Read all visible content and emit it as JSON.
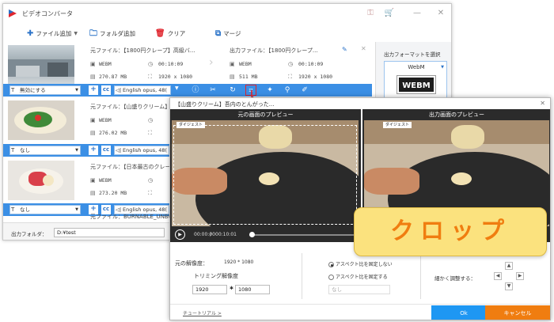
{
  "app": {
    "title": "ビデオコンバータ",
    "colors": {
      "accent": "#3b8fe5",
      "highlight": "#e0262e",
      "ok": "#1e97f3",
      "cancel": "#f07d10"
    }
  },
  "toolbar": {
    "add_file": "ファイル追加",
    "add_folder": "フォルダ追加",
    "clear": "クリア",
    "merge": "マージ"
  },
  "rows": [
    {
      "src_name": "元ファイル：【1800円クレープ】高級バ...",
      "src_format": "WEBM",
      "src_duration": "00:10:09",
      "src_size": "270.87 MB",
      "src_resolution": "1920 x 1080",
      "out_name": "出力ファイル：【1800円クレープ...",
      "out_format": "WEBM",
      "out_duration": "00:10:09",
      "out_size": "511 MB",
      "out_resolution": "1920 x 1080",
      "subtitle": "無効にする",
      "audio": "English opus, 48("
    },
    {
      "src_name": "元ファイル：【山盛りクリーム】",
      "src_format": "WEBM",
      "src_size": "276.02 MB",
      "subtitle": "なし",
      "audio": "English opus, 48("
    },
    {
      "src_name": "元ファイル：【日本最古のクレー",
      "src_format": "WEBM",
      "src_size": "273.20 MB",
      "subtitle": "なし",
      "audio": "English opus, 48("
    },
    {
      "src_name": "元ファイル：BURNABLE_UNBURNABL"
    }
  ],
  "right_panel": {
    "label": "出力フォーマットを選択",
    "format": "WebM",
    "format_logo": "WEBM"
  },
  "bottom": {
    "output_folder_label": "出力フォルダ：",
    "output_folder_value": "D:¥test"
  },
  "crop_dialog": {
    "title": "【山盛りクリーム】吾内のとんがった...",
    "original_preview_label": "元の画面のプレビュー",
    "output_preview_label": "出力画面のプレビュー",
    "stamp": "ダイジェスト",
    "time_current": "00:00:00",
    "time_total": "00:10:01",
    "original_resolution_label": "元の解像度：",
    "original_resolution_value": "1920 * 1080",
    "trim_resolution_label": "トリミング解像度",
    "trim_width": "1920",
    "trim_height": "1080",
    "aspect_unfixed": "アスペクト比を固定しない",
    "aspect_fixed": "アスペクト比を固定する",
    "aspect_select": "なし",
    "fine_adjust_label": "細かく調整する：",
    "tutorial_link": "チュートリアル >",
    "ok": "Ok",
    "cancel": "キャンセル"
  },
  "overlay": {
    "text": "クロップ"
  }
}
